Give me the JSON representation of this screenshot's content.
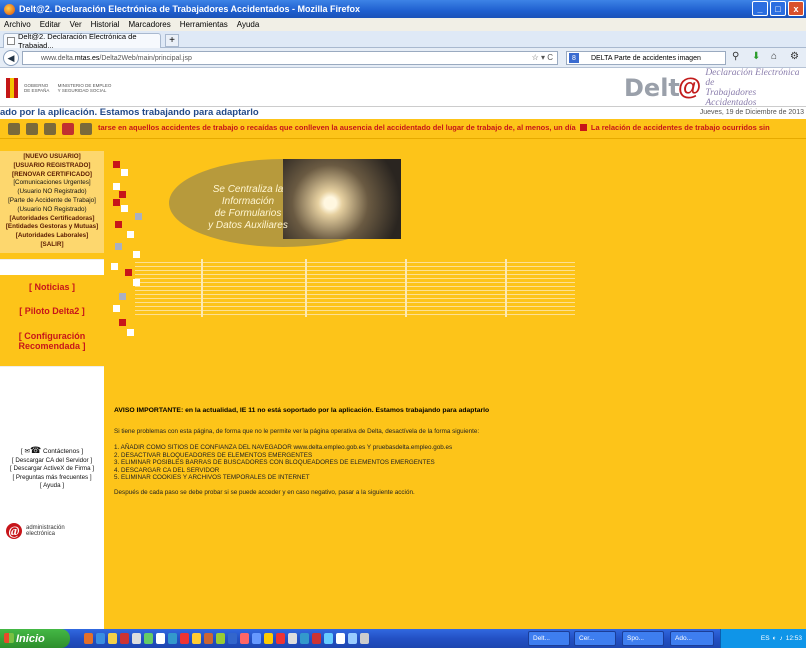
{
  "window": {
    "title": "Delt@2. Declaración Electrónica de Trabajadores Accidentados - Mozilla Firefox",
    "controls": [
      "_",
      "□",
      "x"
    ]
  },
  "menubar": [
    "Archivo",
    "Editar",
    "Ver",
    "Historial",
    "Marcadores",
    "Herramientas",
    "Ayuda"
  ],
  "tab": {
    "label": "Delt@2. Declaración Electrónica de Trabajad...",
    "new_tab": "+"
  },
  "nav": {
    "url_prefix": "www.delta.",
    "url_domain": "mtas.es",
    "url_path": "/Delta2Web/main/principal.jsp",
    "search_engine": "8",
    "search_text": "DELTA Parte de accidentes imagen"
  },
  "site": {
    "gov_label": "GOBIERNO DE ESPAÑA",
    "ministry_label": "MINISTERIO DE EMPLEO Y SEGURIDAD SOCIAL",
    "logo_text": "Delt",
    "logo_at": "@",
    "logo_sub_1": "Declaración Electrónica de",
    "logo_sub_2": "Trabajadores Accidentados",
    "scroll_text": "ado por la aplicación. Estamos trabajando para adaptarlo",
    "date": "Jueves, 19 de Diciembre de 2013",
    "ticker_1": "tarse en aquellos accidentes de trabajo o recaídas que conlleven la ausencia del accidentado del lugar de trabajo de, al menos, un día",
    "ticker_2": "La relación de accidentes de trabajo ocurridos sin"
  },
  "sidebar": {
    "links": [
      {
        "label": "[NUEVO USUARIO]",
        "bold": true
      },
      {
        "label": "[USUARIO REGISTRADO]",
        "bold": true
      },
      {
        "label": "[RENOVAR CERTIFICADO]",
        "bold": true
      },
      {
        "label": "[Comunicaciones Urgentes]",
        "bold": false
      },
      {
        "label": "(Usuario NO Registrado)",
        "bold": false
      },
      {
        "label": "[Parte de Accidente de Trabajo]",
        "bold": false
      },
      {
        "label": "(Usuario NO Registrado)",
        "bold": false
      },
      {
        "label": "[Autoridades Certificadoras]",
        "bold": true
      },
      {
        "label": "[Entidades Gestoras y Mutuas]",
        "bold": true
      },
      {
        "label": "[Autoridades Laborales]",
        "bold": true
      },
      {
        "label": "[SALIR]",
        "bold": true
      }
    ],
    "noticias": "[ Noticias ]",
    "piloto": "[ Piloto Delta2 ]",
    "config": "[ Configuración Recomendada ]",
    "contacto": "Contáctenos ]",
    "contacto_prefix": "[",
    "extras": [
      "[ Descargar CA del Servidor ]",
      "[ Descargar ActiveX de Firma ]",
      "[ Preguntas más frecuentes ]",
      "[ Ayuda ]"
    ],
    "admin_1": "administración",
    "admin_2": "electrónica"
  },
  "banner": {
    "line1": "Se Centraliza la",
    "line2": "Información",
    "line3": "de Formularios",
    "line4": "y Datos Auxiliares"
  },
  "notice": {
    "title": "AVISO IMPORTANTE: en la actualidad, IE 11 no está soportado por la aplicación. Estamos trabajando para adaptarlo",
    "intro": "Si tiene problemas con esta página, de forma que no le permite ver la página operativa de Delta, desactívela de la forma siguiente:",
    "steps": [
      "1.  AÑADIR COMO SITIOS DE CONFIANZA DEL NAVEGADOR www.delta.empleo.gob.es Y pruebasdelta.empleo.gob.es",
      "2.  DESACTIVAR BLOQUEADORES DE ELEMENTOS EMERGENTES",
      "3.  ELIMINAR POSIBLES BARRAS DE BUSCADORES CON BLOQUEADORES DE ELEMENTOS EMERGENTES",
      "4.  DESCARGAR CA DEL SERVIDOR",
      "5.  ELIMINAR COOKIES Y ARCHIVOS TEMPORALES DE INTERNET"
    ],
    "after": "Después de cada paso se debe probar si se puede acceder y en caso negativo, pasar a la siguiente acción."
  },
  "taskbar": {
    "start": "Inicio",
    "tasks": [
      "Delt...",
      "Cer...",
      "Spo...",
      "Ado..."
    ],
    "lang": "ES",
    "time": "12:53"
  },
  "colors": {
    "page_yellow": "#fdc419",
    "link_red": "#c7151a",
    "titlebar_blue": "#1f5fcf"
  }
}
